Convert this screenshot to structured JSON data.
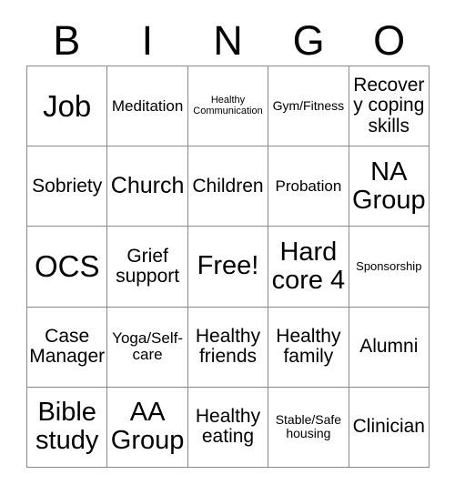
{
  "card": {
    "header_letters": [
      "B",
      "I",
      "N",
      "G",
      "O"
    ],
    "columns": 5,
    "rows": 5,
    "colors": {
      "background": "#ffffff",
      "text": "#000000",
      "grid_line": "#8a8a8a"
    },
    "cells": [
      {
        "label": "Job",
        "size": "fs-xxl",
        "row": 1,
        "col": 1
      },
      {
        "label": "Meditation",
        "size": "fs-sm",
        "row": 1,
        "col": 2
      },
      {
        "label": "Healthy Communication",
        "size": "fs-tiny",
        "row": 1,
        "col": 3
      },
      {
        "label": "Gym/Fitness",
        "size": "fs-xs",
        "row": 1,
        "col": 4
      },
      {
        "label": "Recovery coping skills",
        "size": "fs-md",
        "row": 1,
        "col": 5
      },
      {
        "label": "Sobriety",
        "size": "fs-md",
        "row": 2,
        "col": 1
      },
      {
        "label": "Church",
        "size": "fs-lg",
        "row": 2,
        "col": 2
      },
      {
        "label": "Children",
        "size": "fs-md",
        "row": 2,
        "col": 3
      },
      {
        "label": "Probation",
        "size": "fs-sm",
        "row": 2,
        "col": 4
      },
      {
        "label": "NA Group",
        "size": "fs-xl",
        "row": 2,
        "col": 5
      },
      {
        "label": "OCS",
        "size": "fs-xxl",
        "row": 3,
        "col": 1
      },
      {
        "label": "Grief support",
        "size": "fs-md",
        "row": 3,
        "col": 2
      },
      {
        "label": "Free!",
        "size": "fs-xl",
        "row": 3,
        "col": 3
      },
      {
        "label": "Hard core 4",
        "size": "fs-xl",
        "row": 3,
        "col": 4
      },
      {
        "label": "Sponsorship",
        "size": "fs-xxs",
        "row": 3,
        "col": 5
      },
      {
        "label": "Case Manager",
        "size": "fs-md",
        "row": 4,
        "col": 1
      },
      {
        "label": "Yoga/Self-care",
        "size": "fs-sm",
        "row": 4,
        "col": 2
      },
      {
        "label": "Healthy friends",
        "size": "fs-md",
        "row": 4,
        "col": 3
      },
      {
        "label": "Healthy family",
        "size": "fs-md",
        "row": 4,
        "col": 4
      },
      {
        "label": "Alumni",
        "size": "fs-md",
        "row": 4,
        "col": 5
      },
      {
        "label": "Bible study",
        "size": "fs-xl",
        "row": 5,
        "col": 1
      },
      {
        "label": "AA Group",
        "size": "fs-xl",
        "row": 5,
        "col": 2
      },
      {
        "label": "Healthy eating",
        "size": "fs-md",
        "row": 5,
        "col": 3
      },
      {
        "label": "Stable/Safe housing",
        "size": "fs-xs",
        "row": 5,
        "col": 4
      },
      {
        "label": "Clinician",
        "size": "fs-md",
        "row": 5,
        "col": 5
      }
    ]
  }
}
